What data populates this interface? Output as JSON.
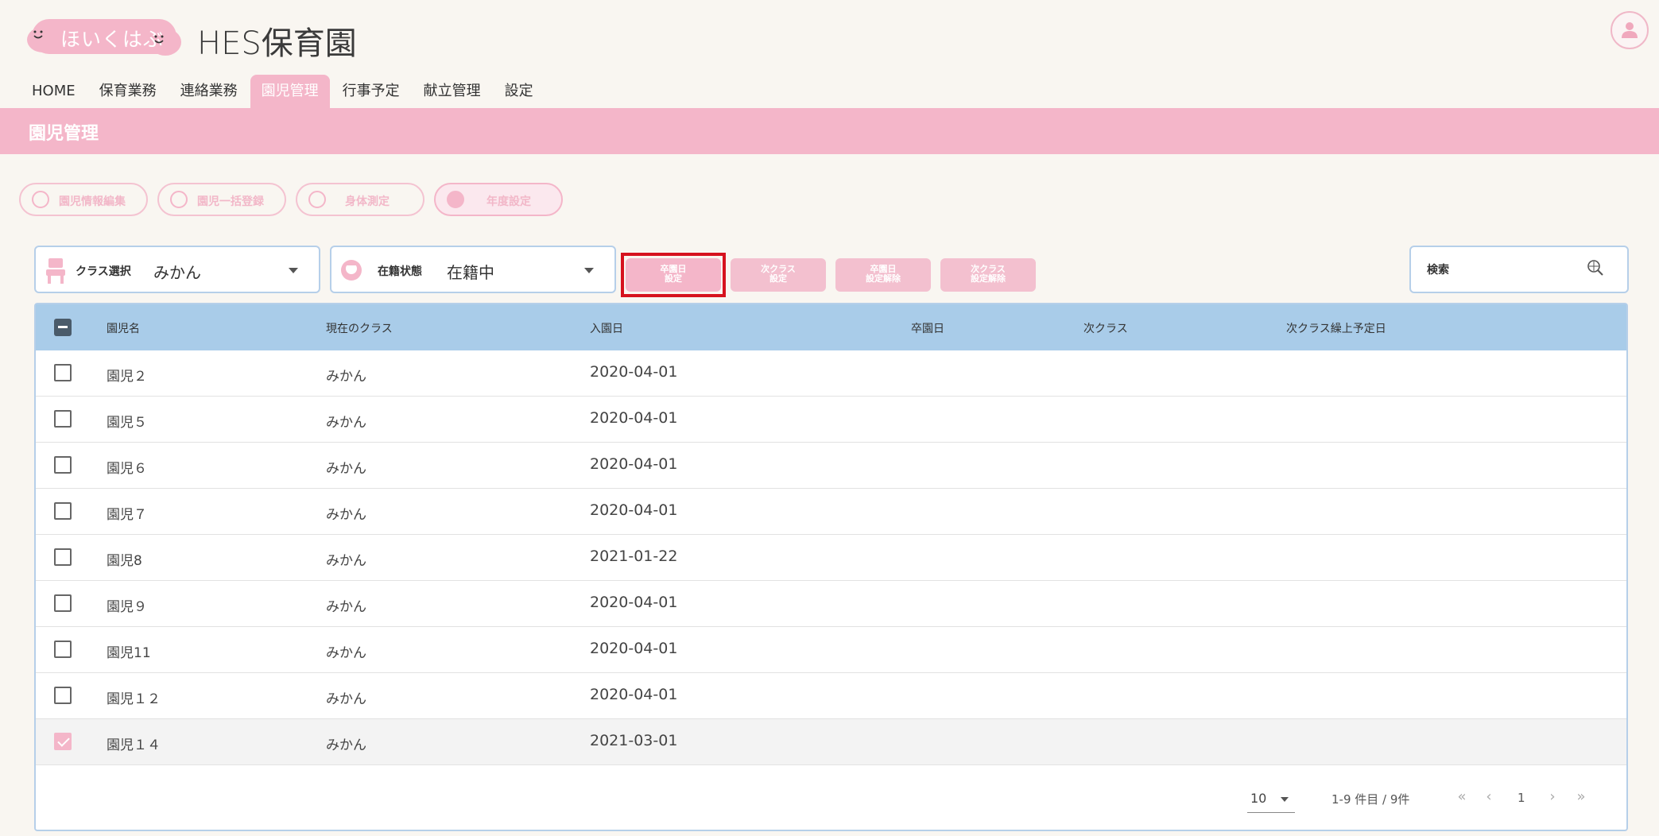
{
  "header": {
    "logo_text": "ほいくはぶ",
    "site_title": "HES保育園"
  },
  "nav": {
    "tabs": [
      {
        "label": "HOME"
      },
      {
        "label": "保育業務"
      },
      {
        "label": "連絡業務"
      },
      {
        "label": "園児管理"
      },
      {
        "label": "行事予定"
      },
      {
        "label": "献立管理"
      },
      {
        "label": "設定"
      }
    ],
    "active_index": 3
  },
  "section": {
    "title": "園児管理"
  },
  "actions": [
    {
      "label": "園児情報編集"
    },
    {
      "label": "園児一括登録"
    },
    {
      "label": "身体測定"
    },
    {
      "label": "年度設定"
    }
  ],
  "filters": {
    "class_label": "クラス選択",
    "class_value": "みかん",
    "status_label": "在籍状態",
    "status_value": "在籍中"
  },
  "buttons": [
    {
      "line1": "卒園日",
      "line2": "設定"
    },
    {
      "line1": "次クラス",
      "line2": "設定"
    },
    {
      "line1": "卒園日",
      "line2": "設定解除"
    },
    {
      "line1": "次クラス",
      "line2": "設定解除"
    }
  ],
  "search": {
    "placeholder": "検索"
  },
  "table": {
    "headers": [
      "園児名",
      "現在のクラス",
      "入園日",
      "卒園日",
      "次クラス",
      "次クラス繰上予定日"
    ],
    "rows": [
      {
        "name": "園児２",
        "class": "みかん",
        "entry": "2020-04-01",
        "grad": "",
        "next": "",
        "next_date": "",
        "checked": false
      },
      {
        "name": "園児５",
        "class": "みかん",
        "entry": "2020-04-01",
        "grad": "",
        "next": "",
        "next_date": "",
        "checked": false
      },
      {
        "name": "園児６",
        "class": "みかん",
        "entry": "2020-04-01",
        "grad": "",
        "next": "",
        "next_date": "",
        "checked": false
      },
      {
        "name": "園児７",
        "class": "みかん",
        "entry": "2020-04-01",
        "grad": "",
        "next": "",
        "next_date": "",
        "checked": false
      },
      {
        "name": "園児8",
        "class": "みかん",
        "entry": "2021-01-22",
        "grad": "",
        "next": "",
        "next_date": "",
        "checked": false
      },
      {
        "name": "園児９",
        "class": "みかん",
        "entry": "2020-04-01",
        "grad": "",
        "next": "",
        "next_date": "",
        "checked": false
      },
      {
        "name": "園児11",
        "class": "みかん",
        "entry": "2020-04-01",
        "grad": "",
        "next": "",
        "next_date": "",
        "checked": false
      },
      {
        "name": "園児１２",
        "class": "みかん",
        "entry": "2020-04-01",
        "grad": "",
        "next": "",
        "next_date": "",
        "checked": false
      },
      {
        "name": "園児１４",
        "class": "みかん",
        "entry": "2021-03-01",
        "grad": "",
        "next": "",
        "next_date": "",
        "checked": true
      }
    ]
  },
  "pagination": {
    "per_page": "10",
    "range": "1-9 件目 / 9件",
    "page": "1",
    "first": "«",
    "prev": "‹",
    "next": "›",
    "last": "»"
  },
  "colors": {
    "accent_pink": "#f4b6c9",
    "table_header": "#a9cce9",
    "highlight_red": "#d6121e"
  }
}
